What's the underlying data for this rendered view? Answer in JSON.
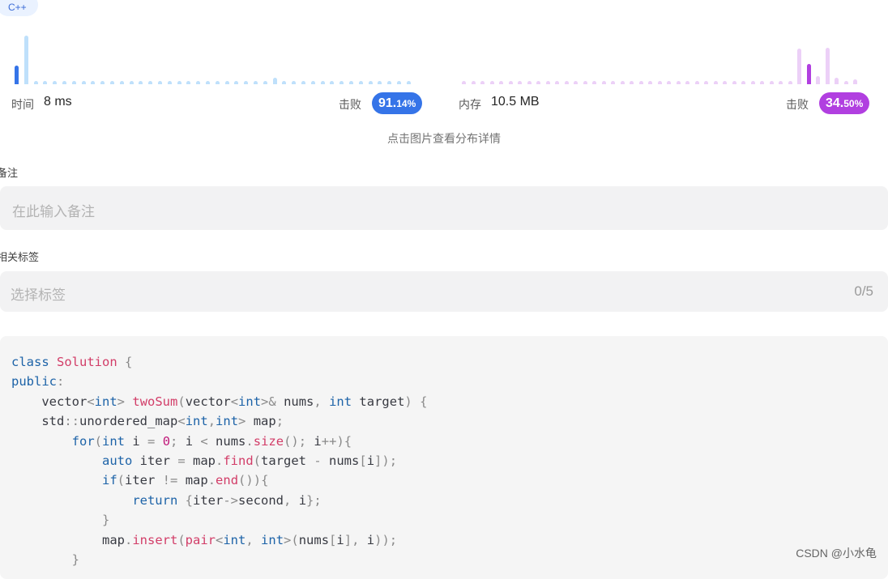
{
  "language_tag": "C++",
  "runtime": {
    "label": "时间",
    "value": "8 ms",
    "beats_label": "击败",
    "beats_main": "91.",
    "beats_small": "14%",
    "beats_percent": 91.14,
    "accent": "#3574e8",
    "dim": "#bfe0fb",
    "bar_levels": [
      0.36,
      0.93,
      0.06,
      0.06,
      0.06,
      0.06,
      0.06,
      0.06,
      0.06,
      0.06,
      0.06,
      0.06,
      0.06,
      0.06,
      0.06,
      0.06,
      0.06,
      0.06,
      0.06,
      0.06,
      0.06,
      0.06,
      0.06,
      0.06,
      0.06,
      0.06,
      0.06,
      0.12,
      0.06,
      0.06,
      0.06,
      0.06,
      0.06,
      0.06,
      0.06,
      0.06,
      0.06,
      0.06,
      0.06,
      0.06,
      0.06,
      0.06
    ],
    "highlight_index": 0
  },
  "memory": {
    "label": "内存",
    "value": "10.5 MB",
    "beats_label": "击败",
    "beats_main": "34.",
    "beats_small": "50%",
    "beats_percent": 34.5,
    "accent": "#b13fe0",
    "dim": "#ecd0f7",
    "bar_levels": [
      0.06,
      0.06,
      0.06,
      0.06,
      0.06,
      0.06,
      0.06,
      0.06,
      0.06,
      0.06,
      0.06,
      0.06,
      0.06,
      0.06,
      0.06,
      0.06,
      0.06,
      0.06,
      0.06,
      0.06,
      0.06,
      0.06,
      0.06,
      0.06,
      0.06,
      0.06,
      0.06,
      0.06,
      0.06,
      0.06,
      0.06,
      0.06,
      0.06,
      0.06,
      0.06,
      0.06,
      0.68,
      0.39,
      0.15,
      0.7,
      0.13,
      0.06,
      0.1
    ],
    "highlight_index": 37
  },
  "chart_hint": "点击图片查看分布详情",
  "notes": {
    "label": "备注",
    "placeholder": "在此输入备注"
  },
  "tags": {
    "label": "相关标签",
    "placeholder": "选择标签",
    "count": "0/5"
  },
  "code_lines": [
    "class Solution {",
    "public:",
    "    vector<int> twoSum(vector<int>& nums, int target) {",
    "    std::unordered_map<int,int> map;",
    "        for(int i = 0; i < nums.size(); i++){",
    "            auto iter = map.find(target - nums[i]);",
    "            if(iter != map.end()){",
    "                return {iter->second, i};",
    "            }",
    "            map.insert(pair<int, int>(nums[i], i));",
    "        }"
  ],
  "watermark": "CSDN @小水龟"
}
